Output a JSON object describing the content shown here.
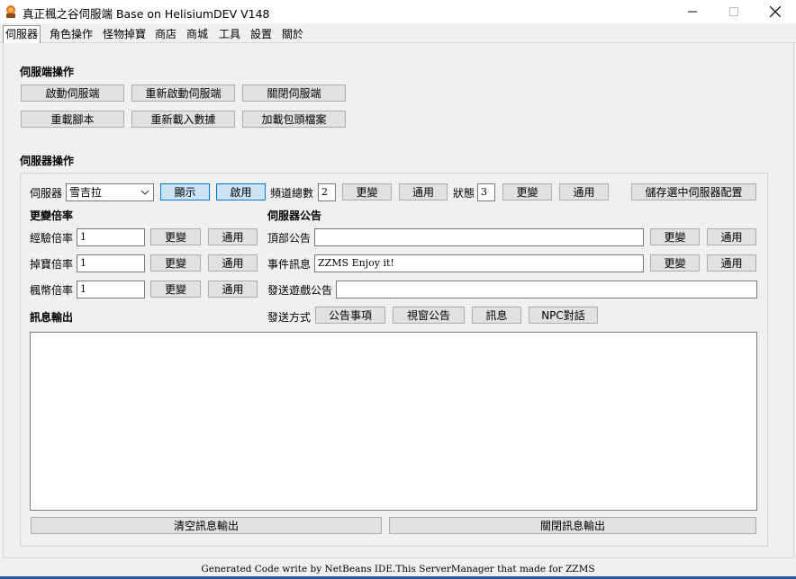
{
  "window": {
    "title": "真正楓之谷伺服端 Base on HelisiumDEV V148"
  },
  "tabs": [
    "伺服器",
    "角色操作",
    "怪物掉寶",
    "商店",
    "商城",
    "工具",
    "設置",
    "關於"
  ],
  "server_ops": {
    "title": "伺服端操作",
    "start": "啟動伺服端",
    "restart": "重新啟動伺服端",
    "shutdown": "關閉伺服端",
    "reload_script": "重載腳本",
    "reload_data": "重新載入數據",
    "load_packet": "加載包頭檔案"
  },
  "server_manage": {
    "title": "伺服器操作",
    "server_label": "伺服器",
    "server_value": "雪吉拉",
    "show": "顯示",
    "enable": "啟用",
    "channel_label": "頻道總數",
    "channel_value": "2",
    "change": "更變",
    "apply": "通用",
    "status_label": "狀態",
    "status_value": "3",
    "save_config": "儲存選中伺服器配置"
  },
  "rates": {
    "title": "更變倍率",
    "exp_label": "經驗倍率",
    "exp_value": "1",
    "drop_label": "掉寶倍率",
    "drop_value": "1",
    "meso_label": "楓幣倍率",
    "meso_value": "1",
    "change": "更變",
    "apply": "通用"
  },
  "notice": {
    "title": "伺服器公告",
    "top_label": "頂部公告",
    "top_value": "",
    "event_label": "事件訊息",
    "event_value": "ZZMS Enjoy it!",
    "send_label": "發送遊戲公告",
    "send_value": "",
    "change": "更變",
    "apply": "通用",
    "method_label": "發送方式",
    "methods": [
      "公告事項",
      "視窗公告",
      "訊息",
      "NPC對話"
    ]
  },
  "output": {
    "title": "訊息輸出",
    "clear": "清空訊息輸出",
    "close": "關閉訊息輸出"
  },
  "footer": "Generated Code write by NetBeans IDE.This ServerManager that made for ZZMS"
}
